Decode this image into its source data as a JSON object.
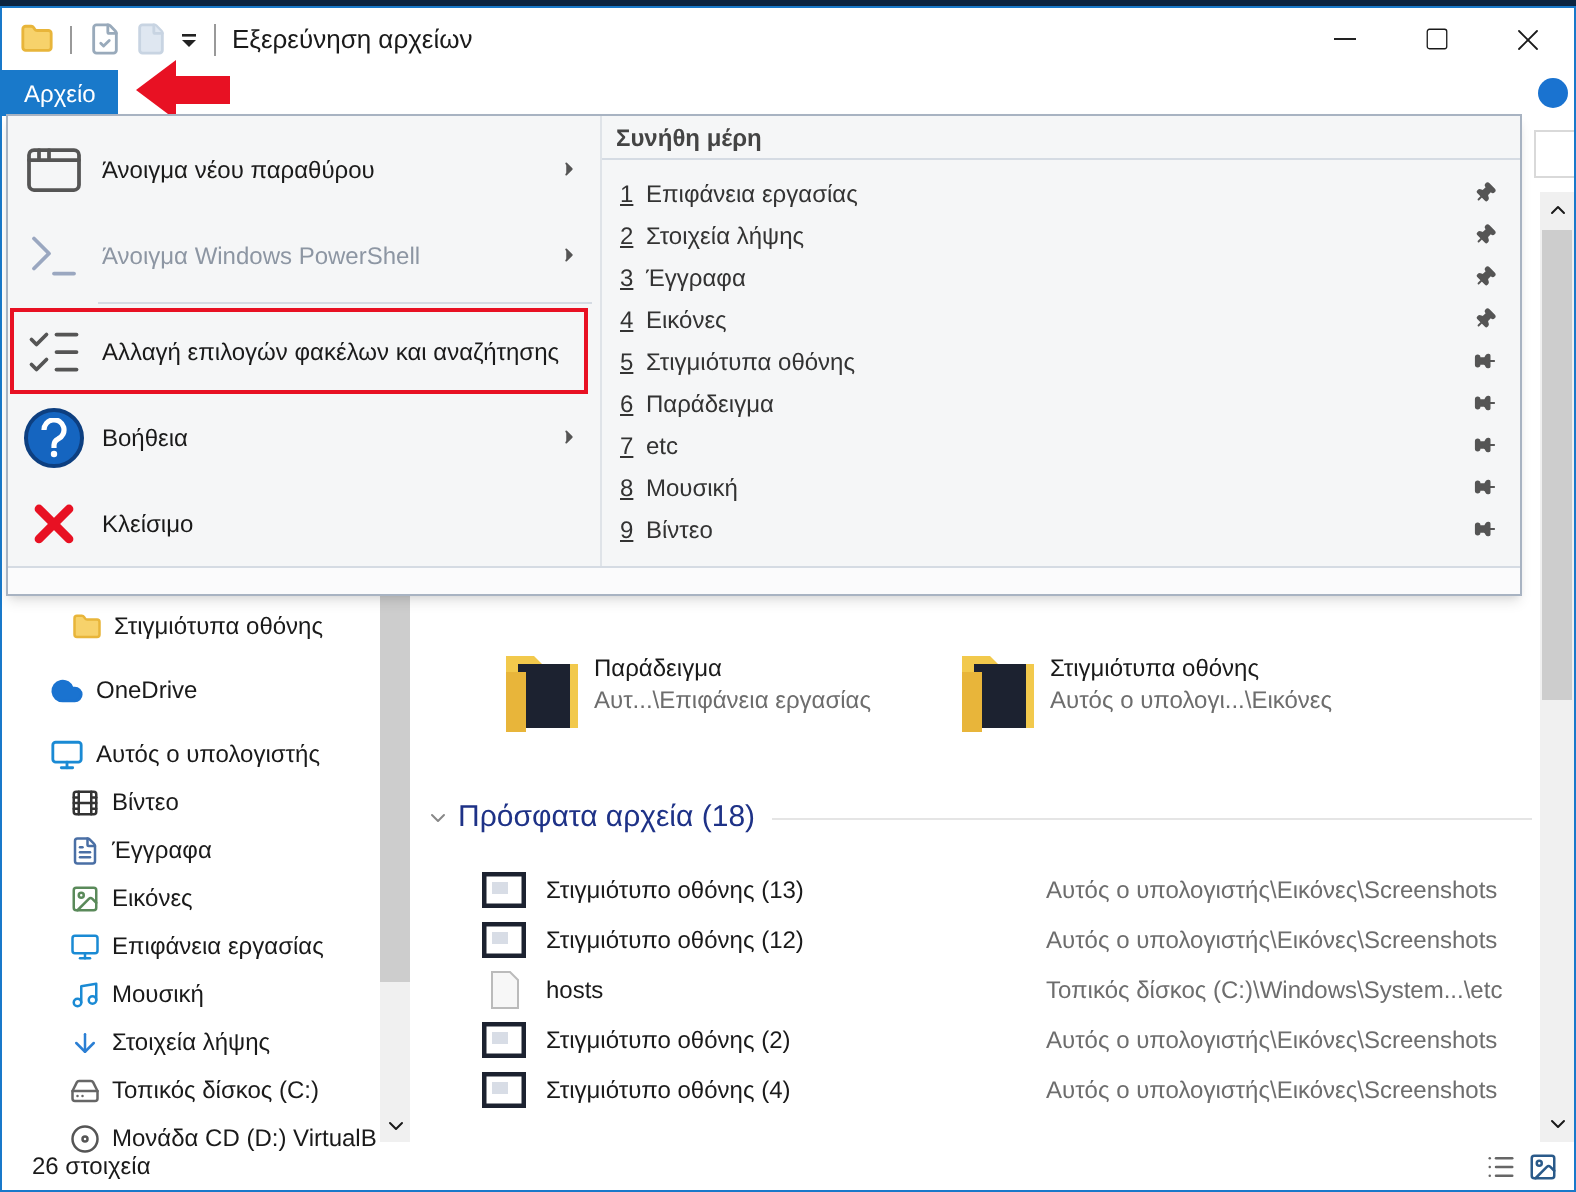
{
  "window": {
    "title": "Εξερεύνηση αρχείων"
  },
  "ribbon": {
    "file_tab": {
      "label": "Αρχείο",
      "selected": true
    }
  },
  "file_menu": {
    "items": [
      {
        "label": "Άνοιγμα νέου παραθύρου",
        "disabled": false,
        "has_submenu": true,
        "highlighted": false,
        "divider_after": false
      },
      {
        "label": "Άνοιγμα Windows PowerShell",
        "disabled": true,
        "has_submenu": true,
        "highlighted": false,
        "divider_after": true
      },
      {
        "label": "Αλλαγή επιλογών φακέλων και αναζήτησης",
        "disabled": false,
        "has_submenu": false,
        "highlighted": true,
        "divider_after": false
      },
      {
        "label": "Βοήθεια",
        "disabled": false,
        "has_submenu": true,
        "highlighted": false,
        "divider_after": false
      },
      {
        "label": "Κλείσιμο",
        "disabled": false,
        "has_submenu": false,
        "highlighted": false,
        "divider_after": false
      }
    ],
    "frequent_places": {
      "title": "Συνήθη μέρη",
      "items": [
        {
          "number": "1",
          "label": "Επιφάνεια εργασίας",
          "pinned": true
        },
        {
          "number": "2",
          "label": "Στοιχεία λήψης",
          "pinned": true
        },
        {
          "number": "3",
          "label": "Έγγραφα",
          "pinned": true
        },
        {
          "number": "4",
          "label": "Εικόνες",
          "pinned": true
        },
        {
          "number": "5",
          "label": "Στιγμιότυπα οθόνης",
          "pinned": false
        },
        {
          "number": "6",
          "label": "Παράδειγμα",
          "pinned": false
        },
        {
          "number": "7",
          "label": "etc",
          "pinned": false
        },
        {
          "number": "8",
          "label": "Μουσική",
          "pinned": false
        },
        {
          "number": "9",
          "label": "Βίντεο",
          "pinned": false
        }
      ]
    }
  },
  "navigation": {
    "quick_access_items": [
      {
        "label": "Στιγμιότυπα οθόνης"
      }
    ],
    "items": [
      {
        "label": "OneDrive"
      },
      {
        "label": "Αυτός ο υπολογιστής",
        "children": [
          {
            "label": "Βίντεο"
          },
          {
            "label": "Έγγραφα"
          },
          {
            "label": "Εικόνες"
          },
          {
            "label": "Επιφάνεια εργασίας"
          },
          {
            "label": "Μουσική"
          },
          {
            "label": "Στοιχεία λήψης"
          },
          {
            "label": "Τοπικός δίσκος (C:)"
          },
          {
            "label": "Μονάδα CD (D:) VirtualB"
          }
        ]
      }
    ]
  },
  "content": {
    "folders": [
      {
        "name": "Παράδειγμα",
        "location": "Αυτ...\\Επιφάνεια εργασίας"
      },
      {
        "name": "Στιγμιότυπα οθόνης",
        "location": "Αυτός ο υπολογι...\\Εικόνες"
      }
    ],
    "recent": {
      "title": "Πρόσφατα αρχεία (18)",
      "expanded": true,
      "rows": [
        {
          "kind": "image",
          "name": "Στιγμιότυπο οθόνης (13)",
          "location": "Αυτός ο υπολογιστής\\Εικόνες\\Screenshots"
        },
        {
          "kind": "image",
          "name": "Στιγμιότυπο οθόνης (12)",
          "location": "Αυτός ο υπολογιστής\\Εικόνες\\Screenshots"
        },
        {
          "kind": "file",
          "name": "hosts",
          "location": "Τοπικός δίσκος (C:)\\Windows\\System...\\etc"
        },
        {
          "kind": "image",
          "name": "Στιγμιότυπο οθόνης (2)",
          "location": "Αυτός ο υπολογιστής\\Εικόνες\\Screenshots"
        },
        {
          "kind": "image",
          "name": "Στιγμιότυπο οθόνης (4)",
          "location": "Αυτός ο υπολογιστής\\Εικόνες\\Screenshots"
        }
      ]
    }
  },
  "status_bar": {
    "item_count": "26 στοιχεία"
  }
}
